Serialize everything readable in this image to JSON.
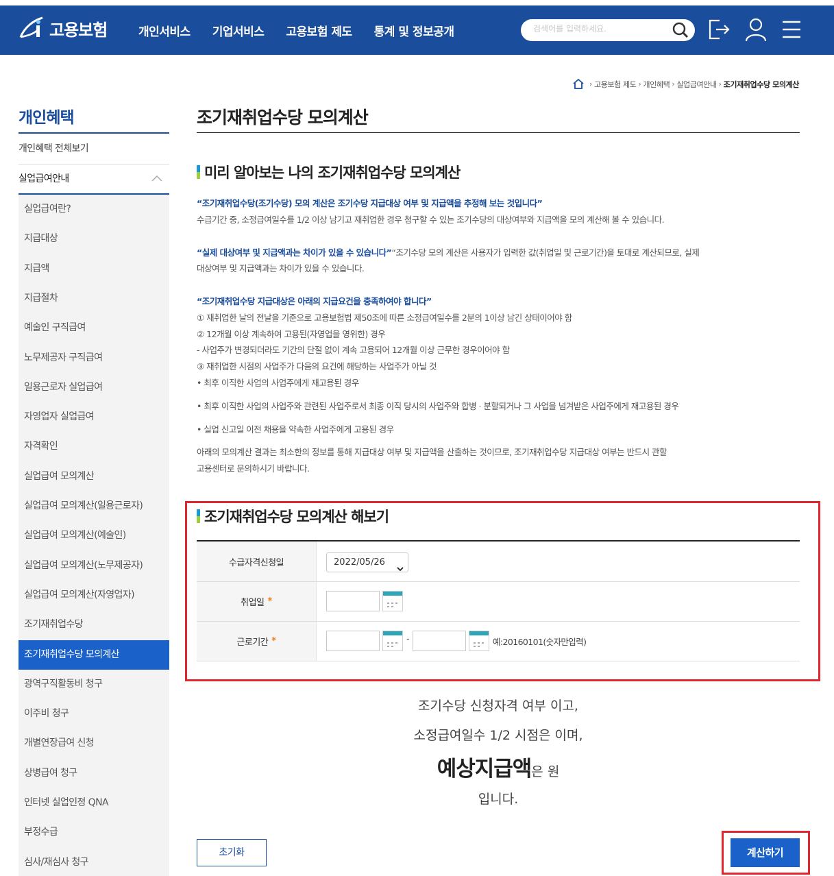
{
  "header": {
    "logo_text": "고용보험",
    "nav": [
      "개인서비스",
      "기업서비스",
      "고용보험 제도",
      "통계 및 정보공개"
    ],
    "search_placeholder": "검색어를 입력하세요."
  },
  "breadcrumb": [
    "고용보험 제도",
    "개인혜택",
    "실업급여안내",
    "조기재취업수당 모의계산"
  ],
  "sidebar": {
    "title": "개인혜택",
    "all": "개인혜택 전체보기",
    "group": "실업급여안내",
    "items": [
      {
        "label": "실업급여란?"
      },
      {
        "label": "지급대상"
      },
      {
        "label": "지급액"
      },
      {
        "label": "지급절차"
      },
      {
        "label": "예술인 구직급여"
      },
      {
        "label": "노무제공자 구직급여"
      },
      {
        "label": "일용근로자 실업급여"
      },
      {
        "label": "자영업자 실업급여"
      },
      {
        "label": "자격확인"
      },
      {
        "label": "실업급여 모의계산"
      },
      {
        "label": "실업급여 모의계산(일용근로자)"
      },
      {
        "label": "실업급여 모의계산(예술인)"
      },
      {
        "label": "실업급여 모의계산(노무제공자)"
      },
      {
        "label": "실업급여 모의계산(자영업자)"
      },
      {
        "label": "조기재취업수당"
      },
      {
        "label": "조기재취업수당 모의계산",
        "active": true
      },
      {
        "label": "광역구직활동비 청구"
      },
      {
        "label": "이주비 청구"
      },
      {
        "label": "개별연장급여 신청"
      },
      {
        "label": "상병급여 청구"
      },
      {
        "label": "인터넷 실업인정 QNA"
      },
      {
        "label": "부정수급"
      },
      {
        "label": "심사/재심사 청구"
      }
    ]
  },
  "main": {
    "title": "조기재취업수당 모의계산",
    "section1_title": "미리 알아보는 나의 조기재취업수당 모의계산",
    "p1_head": "“조기재취업수당(조기수당) 모의 계산은 조기수당 지급대상 여부 및 지급액을 추정해 보는 것입니다”",
    "p1_body": "수급기간 중, 소정급여일수를 1/2 이상 남기고 재취업한 경우 청구할 수 있는 조기수당의 대상여부와 지급액을 모의 계산해 볼 수 있습니다.",
    "p2_head": "“실제 대상여부 및 지급액과는 차이가 있을 수 있습니다”",
    "p2_body_1": "“조기수당 모의 계산은 사용자가 입력한 값(취업일 및 근로기간)을 토대로 계산되므로, 실제",
    "p2_body_2": "대상여부 및 지급액과는 차이가 있을 수 있습니다.",
    "p3_head": "“조기재취업수당 지급대상은 아래의 지급요건을 충족하여야 합니다”",
    "p3_lines": [
      "① 재취업한 날의 전날을 기준으로 고용보험법 제50조에 따른 소정급여일수를 2분의 1이상 남긴 상태이어야 함",
      "② 12개월 이상 계속하여 고용된(자영업을 영위한) 경우",
      "- 사업주가 변경되더라도 기간의 단절 없이 계속 고용되어 12개월 이상 근무한 경우이어야 함",
      "③ 재취업한 시점의 사업주가 다음의 요건에 해당하는 사업주가 아닐 것",
      "• 최후 이직한 사업의 사업주에게 재고용된 경우"
    ],
    "bullet2": "• 최후 이직한 사업의 사업주와 관련된 사업주로서 최종 이직 당시의 사업주와 합병 · 분할되거나 그 사업을 넘겨받은 사업주에게 재고용된 경우",
    "bullet3": "• 실업 신고일 이전 채용을 약속한 사업주에게 고용된 경우",
    "notice_1": "아래의 모의계산 결과는 최소한의 정보를 통해 지급대상 여부 및 지급액을 산출하는 것이므로, 조기재취업수당 지급대상 여부는 반드시 관할",
    "notice_2": "고용센터로 문의하시기 바랍니다.",
    "section2_title": "조기재취업수당 모의계산 해보기"
  },
  "form": {
    "apply_date_label": "수급자격신청일",
    "apply_date_value": "2022/05/26",
    "job_date_label": "취업일",
    "work_period_label": "근로기간",
    "required_mark": "*",
    "dash": "-",
    "hint": "예:20160101(숫자만입력)"
  },
  "result": {
    "line1": "조기수당 신청자격 여부 이고,",
    "line2": "소정급여일수 1/2 시점은 이며,",
    "big": "예상지급액",
    "small": "은 원",
    "line4": "입니다."
  },
  "buttons": {
    "reset": "초기화",
    "calc": "계산하기"
  },
  "colors": {
    "primary": "#1a4d9c",
    "button": "#1a62c9",
    "highlight": "#e0262e"
  }
}
